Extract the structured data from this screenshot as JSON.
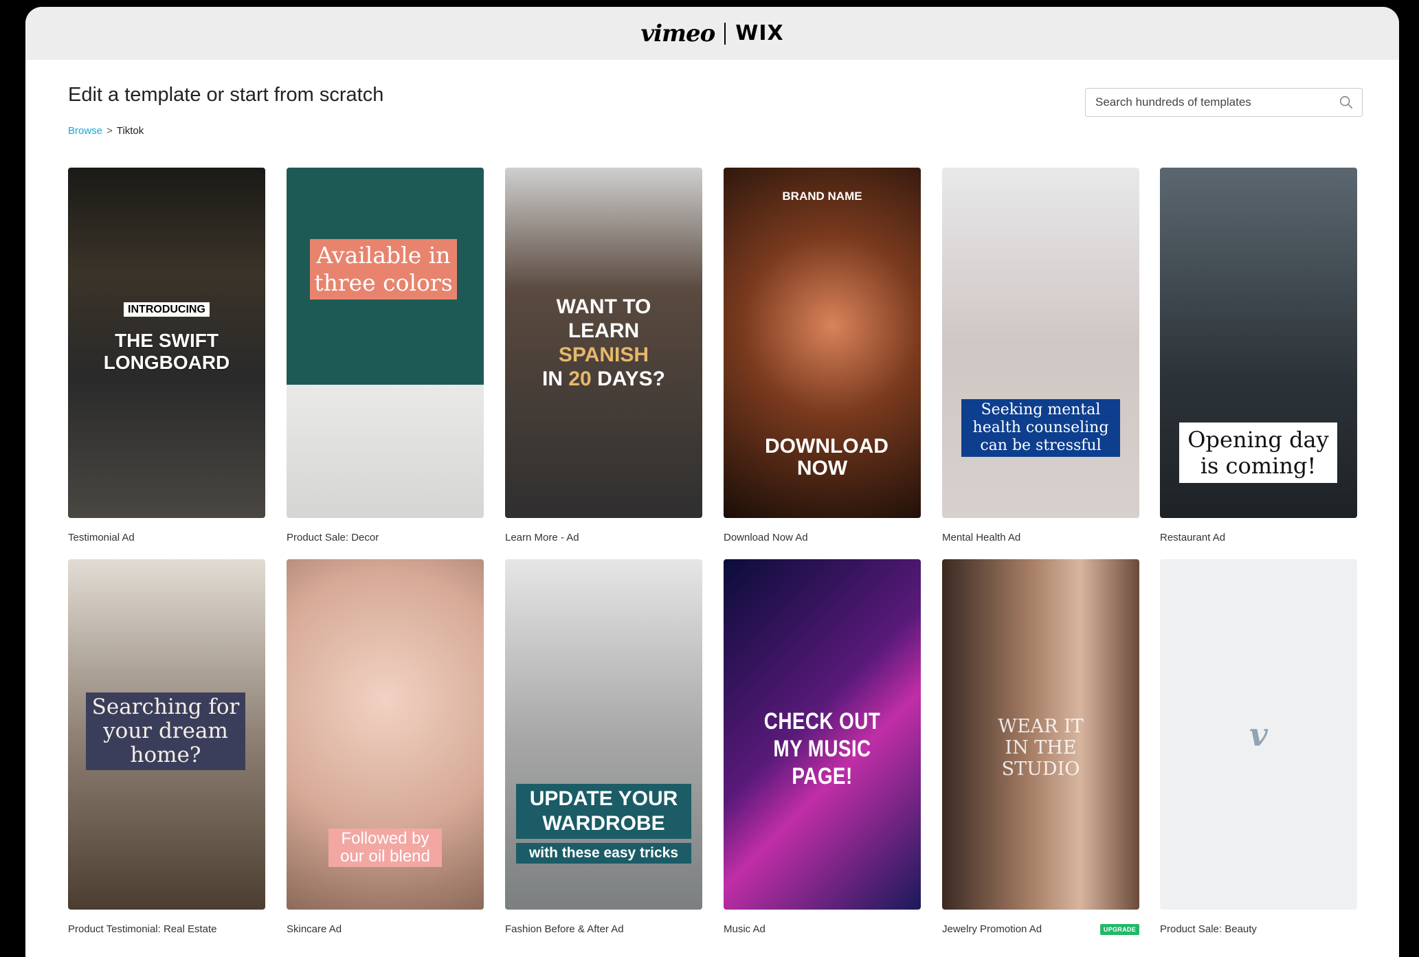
{
  "header": {
    "brand_vimeo": "vimeo",
    "brand_wix": "WIX"
  },
  "page": {
    "title": "Edit a template or start from scratch",
    "breadcrumb": [
      {
        "label": "Browse"
      },
      {
        "label": "Tiktok"
      }
    ],
    "breadcrumb_separator": ">"
  },
  "search": {
    "placeholder": "Search hundreds of templates"
  },
  "templates": [
    {
      "name": "Testimonial Ad",
      "overlay": [
        "INTRODUCING",
        "THE SWIFT LONGBOARD"
      ]
    },
    {
      "name": "Product Sale: Decor",
      "overlay": [
        "Available in three colors"
      ]
    },
    {
      "name": "Learn More - Ad",
      "overlay": [
        "WANT TO LEARN",
        "SPANISH",
        "IN",
        "20",
        "DAYS?"
      ]
    },
    {
      "name": "Download Now Ad",
      "overlay": [
        "BRAND NAME",
        "DOWNLOAD NOW"
      ]
    },
    {
      "name": "Mental Health Ad",
      "overlay": [
        "Seeking mental health counseling can be stressful"
      ]
    },
    {
      "name": "Restaurant Ad",
      "overlay": [
        "Opening day is coming!"
      ]
    },
    {
      "name": "Product Testimonial: Real Estate",
      "overlay": [
        "Searching for your dream home?"
      ]
    },
    {
      "name": "Skincare Ad",
      "overlay": [
        "Followed by our oil blend"
      ]
    },
    {
      "name": "Fashion Before & After Ad",
      "overlay": [
        "UPDATE YOUR WARDROBE",
        "with these easy tricks"
      ]
    },
    {
      "name": "Music Ad",
      "overlay": [
        "CHECK OUT MY MUSIC PAGE!"
      ]
    },
    {
      "name": "Jewelry Promotion Ad",
      "overlay": [
        "WEAR IT IN THE STUDIO"
      ],
      "badge": "UPGRADE"
    },
    {
      "name": "Product Sale: Beauty",
      "overlay": [
        "v"
      ]
    }
  ],
  "colors": {
    "link": "#1aa4d8",
    "badge": "#23b868",
    "topbar": "#ededed"
  }
}
